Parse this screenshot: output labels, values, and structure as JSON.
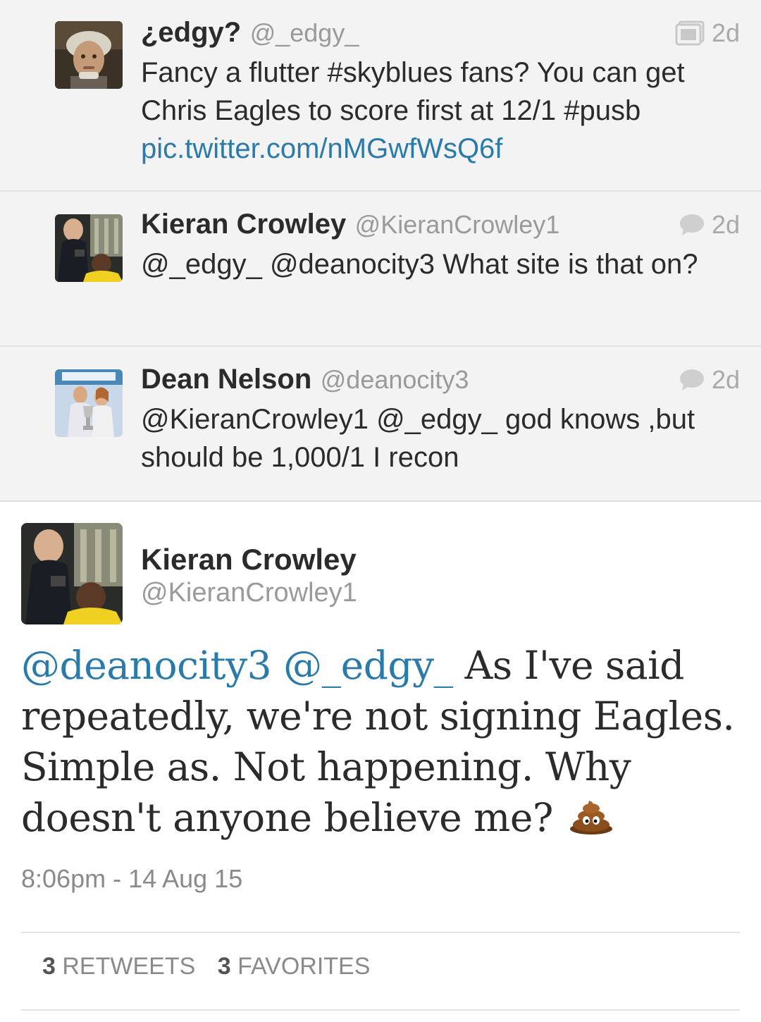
{
  "thread": [
    {
      "name": "¿edgy?",
      "handle": "@_edgy_",
      "time": "2d",
      "meta_icon": "image-icon",
      "text_before_link": "Fancy a flutter #skyblues fans? You can get Chris Eagles to score first at 12/1 #pusb",
      "link": "pic.twitter.com/nMGwfWsQ6f"
    },
    {
      "name": "Kieran Crowley",
      "handle": "@KieranCrowley1",
      "time": "2d",
      "meta_icon": "reply-bubble-icon",
      "text": "@_edgy_ @deanocity3 What site is that on?"
    },
    {
      "name": "Dean Nelson",
      "handle": "@deanocity3",
      "time": "2d",
      "meta_icon": "reply-bubble-icon",
      "text": "@KieranCrowley1 @_edgy_ god knows ,but should be 1,000/1 I recon"
    }
  ],
  "main": {
    "name": "Kieran Crowley",
    "handle": "@KieranCrowley1",
    "mention1": "@deanocity3",
    "mention2": "@_edgy_",
    "text": "As I've said repeatedly, we're not signing Eagles. Simple as. Not happening. Why doesn't anyone believe me?",
    "emoji": "pile-of-poo-emoji",
    "date": "8:06pm - 14 Aug 15",
    "retweets_count": "3",
    "retweets_label": "RETWEETS",
    "favorites_count": "3",
    "favorites_label": "FAVORITES"
  },
  "colors": {
    "link": "#2a7aaa",
    "thread_bg": "#f3f3f3",
    "muted": "#9a9a9a"
  }
}
